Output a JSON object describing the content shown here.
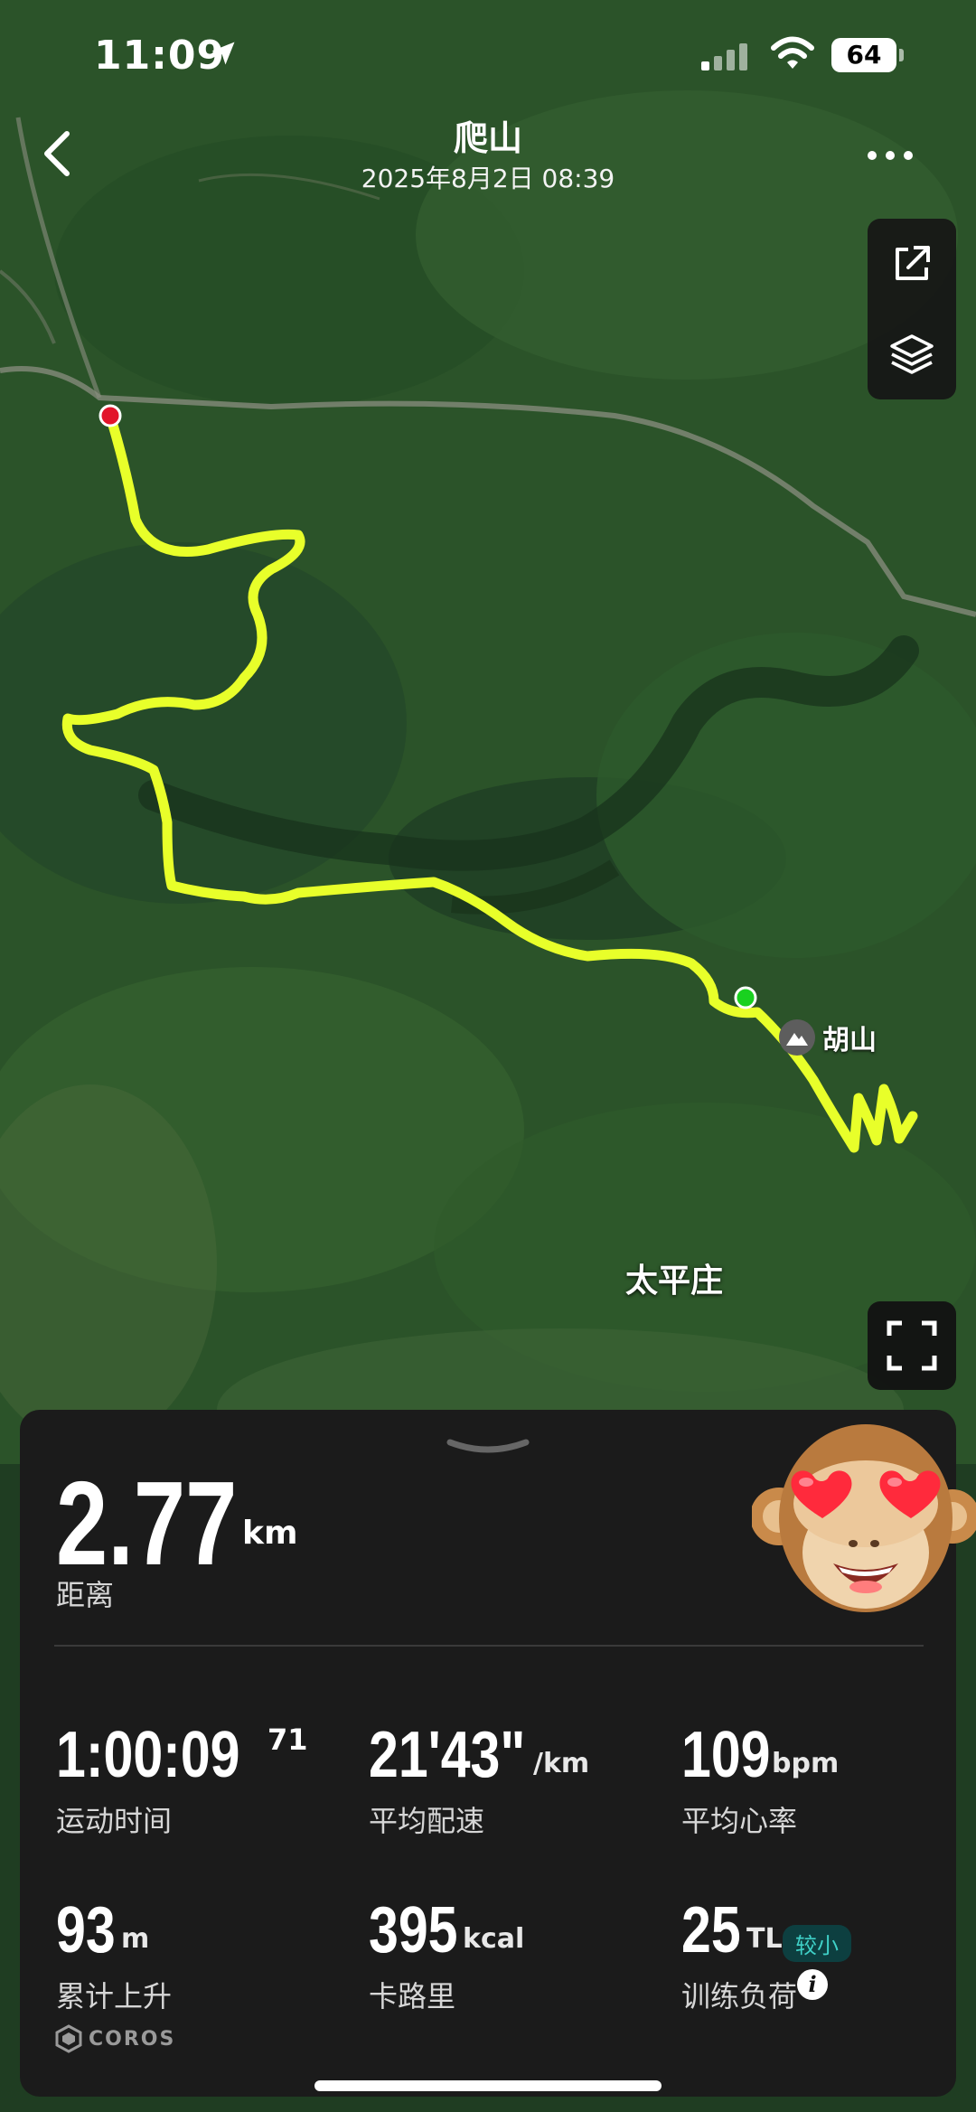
{
  "status": {
    "time": "11:09",
    "battery": "64"
  },
  "header": {
    "title": "爬山",
    "date": "2025年8月2日 08:39"
  },
  "map": {
    "poi_label": "胡山",
    "place_label": "太平庄",
    "route_color": "#e8ff2a",
    "start_marker_color": "#19d11f",
    "end_marker_color": "#e2142b"
  },
  "summary": {
    "distance_value": "2.77",
    "distance_unit": "km",
    "distance_label": "距离"
  },
  "metrics": {
    "duration": {
      "value": "1:00:09",
      "sup": "71",
      "label": "运动时间"
    },
    "pace": {
      "value": "21'43\"",
      "unit": "/km",
      "label": "平均配速"
    },
    "heart_rate": {
      "value": "109",
      "unit": "bpm",
      "label": "平均心率"
    },
    "ascent": {
      "value": "93",
      "unit": "m",
      "label": "累计上升"
    },
    "calories": {
      "value": "395",
      "unit": "kcal",
      "label": "卡路里"
    },
    "training_load": {
      "value": "25",
      "unit": "TL",
      "badge": "较小",
      "label": "训练负荷"
    }
  },
  "brand": {
    "name": "COROS"
  },
  "icons": {
    "back": "chevron-left-icon",
    "more": "ellipsis-icon",
    "share": "share-icon",
    "layers": "layers-icon",
    "fullscreen": "fullscreen-icon",
    "info": "info-icon",
    "avatar": "monkey-heart-eyes-icon"
  }
}
